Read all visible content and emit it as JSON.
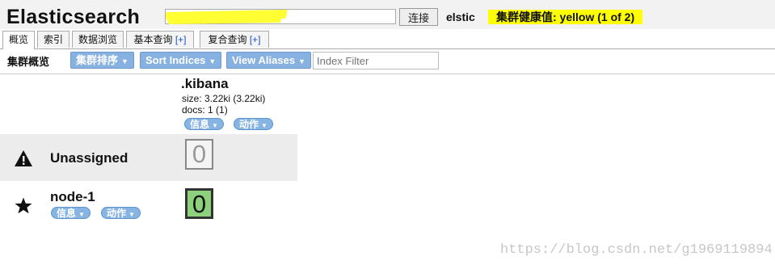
{
  "header": {
    "title": "Elasticsearch",
    "url_value": "",
    "connect_label": "连接",
    "cluster_name": "elstic",
    "health": "集群健康值: yellow (1 of 2)"
  },
  "tabs": [
    {
      "label": "概览",
      "suffix": ""
    },
    {
      "label": "索引",
      "suffix": ""
    },
    {
      "label": "数据浏览",
      "suffix": ""
    },
    {
      "label": "基本查询",
      "suffix": "[+]"
    },
    {
      "label": "复合查询",
      "suffix": "[+]"
    }
  ],
  "toolbar": {
    "title": "集群概览",
    "sort_cluster": "集群排序",
    "sort_indices": "Sort Indices",
    "view_aliases": "View Aliases",
    "filter_placeholder": "Index Filter"
  },
  "index": {
    "name": ".kibana",
    "size": "size: 3.22ki (3.22ki)",
    "docs": "docs: 1 (1)",
    "info_label": "信息",
    "action_label": "动作"
  },
  "rows": {
    "unassigned": {
      "label": "Unassigned",
      "shard": "0"
    },
    "node": {
      "label": "node-1",
      "shard": "0",
      "info_label": "信息",
      "action_label": "动作"
    }
  },
  "colors": {
    "health_badge": "#ffff00",
    "button_blue": "#87b1e0",
    "shard_started": "#8ed17c"
  },
  "icons": {
    "unassigned": "warning-icon",
    "node": "star-icon",
    "dropdown": "caret-down-icon"
  },
  "watermark": "https://blog.csdn.net/g1969119894"
}
